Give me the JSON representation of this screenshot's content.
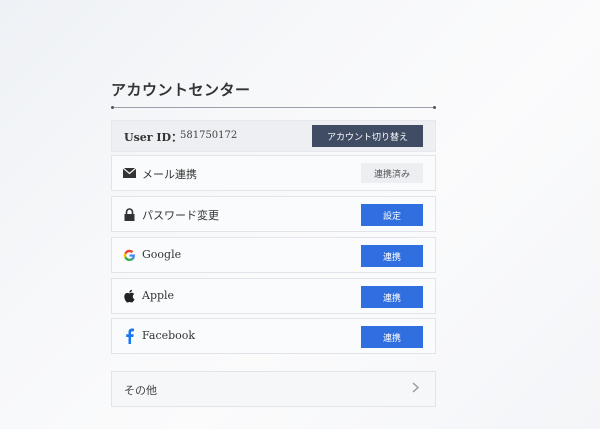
{
  "page": {
    "title": "アカウントセンター"
  },
  "user": {
    "id_label": "User ID：",
    "id_value": "581750172",
    "switch_button": "アカウント切り替え"
  },
  "rows": [
    {
      "icon": "mail-icon",
      "label": "メール連携",
      "action": "連携済み",
      "action_style": "gray"
    },
    {
      "icon": "lock-icon",
      "label": "パスワード変更",
      "action": "設定",
      "action_style": "blue"
    },
    {
      "icon": "google-icon",
      "label": "Google",
      "action": "連携",
      "action_style": "blue"
    },
    {
      "icon": "apple-icon",
      "label": "Apple",
      "action": "連携",
      "action_style": "blue"
    },
    {
      "icon": "facebook-icon",
      "label": "Facebook",
      "action": "連携",
      "action_style": "blue"
    }
  ],
  "other": {
    "label": "その他",
    "icon": "chevron-right-icon"
  },
  "colors": {
    "primary_button": "#2f6fe0",
    "dark_button": "#3f4c63",
    "text": "#333333"
  }
}
